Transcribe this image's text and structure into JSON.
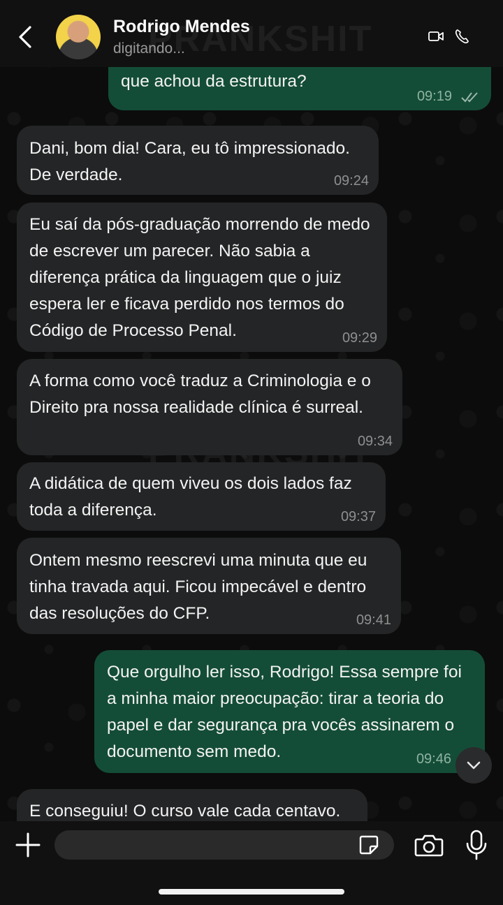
{
  "header": {
    "contact_name": "Rodrigo Mendes",
    "status": "digitando...",
    "watermark": "PRANKSHIT"
  },
  "messages": [
    {
      "dir": "out",
      "text": "módulo de Elaboração de Laudos ontem. O que achou da estrutura?",
      "time": "09:19",
      "read": true
    },
    {
      "dir": "in",
      "text": "Dani, bom dia! Cara, eu tô impressionado. De verdade.",
      "time": "09:24"
    },
    {
      "dir": "in",
      "text": "Eu saí da pós-graduação morrendo de medo de escrever um parecer. Não sabia a diferença prática da linguagem que o juiz espera ler e ficava perdido nos termos do Código de Processo Penal.",
      "time": "09:29"
    },
    {
      "dir": "in",
      "text": "A forma como você traduz a Criminologia e o Direito pra nossa realidade clínica é surreal.",
      "time": "09:34"
    },
    {
      "dir": "in",
      "text": "A didática de quem viveu os dois lados faz toda a diferença.",
      "time": "09:37"
    },
    {
      "dir": "in",
      "text": "Ontem mesmo reescrevi uma minuta que eu tinha travada aqui. Ficou impecável e dentro das resoluções do CFP.",
      "time": "09:41"
    },
    {
      "dir": "out",
      "text": "Que orgulho ler isso, Rodrigo! Essa sempre foi a minha maior preocupação: tirar a teoria do papel e dar segurança pra vocês assinarem o documento sem medo.",
      "time": "09:46"
    },
    {
      "dir": "in",
      "text": "E conseguiu! O curso vale cada centavo.",
      "time": ""
    }
  ],
  "input": {
    "placeholder": "",
    "value": ""
  },
  "colors": {
    "incoming": "#242526",
    "outgoing": "#144d37",
    "header": "#111111"
  },
  "icons": [
    "back-arrow-icon",
    "video-call-icon",
    "phone-icon",
    "plus-icon",
    "sticker-icon",
    "camera-icon",
    "microphone-icon",
    "chevron-down-icon",
    "double-check-icon"
  ]
}
